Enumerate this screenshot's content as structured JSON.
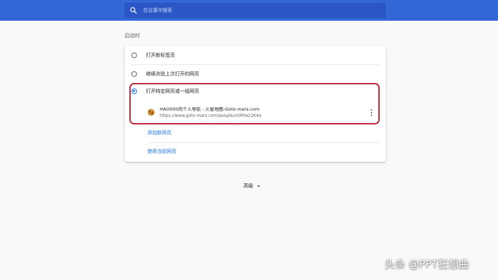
{
  "search": {
    "placeholder": "在设置中搜索",
    "icon": "search-icon"
  },
  "startup": {
    "section_title": "启动时",
    "options": [
      {
        "label": "打开新标签页",
        "selected": false
      },
      {
        "label": "继续浏览上次打开的网页",
        "selected": false
      },
      {
        "label": "打开特定网页或一组网页",
        "selected": true
      }
    ],
    "page": {
      "title": "HAO000的个人导航 - 火星地图-Goto-mars.com",
      "url": "https://www.goto-mars.com/people/xOMYa22K4q",
      "favicon": "mars-favicon-icon",
      "menu_icon": "more-vert-icon"
    },
    "add_page_label": "添加新网页",
    "use_current_label": "使用当前网页"
  },
  "advanced": {
    "label": "高级",
    "icon": "chevron-down-icon"
  },
  "watermark": "头条 @PPT狂想曲",
  "colors": {
    "header": "#3367d6",
    "search_bg": "#2a56c6",
    "accent": "#1a73e8",
    "highlight_border": "#c0283b",
    "page_bg": "#f8f9fa"
  }
}
